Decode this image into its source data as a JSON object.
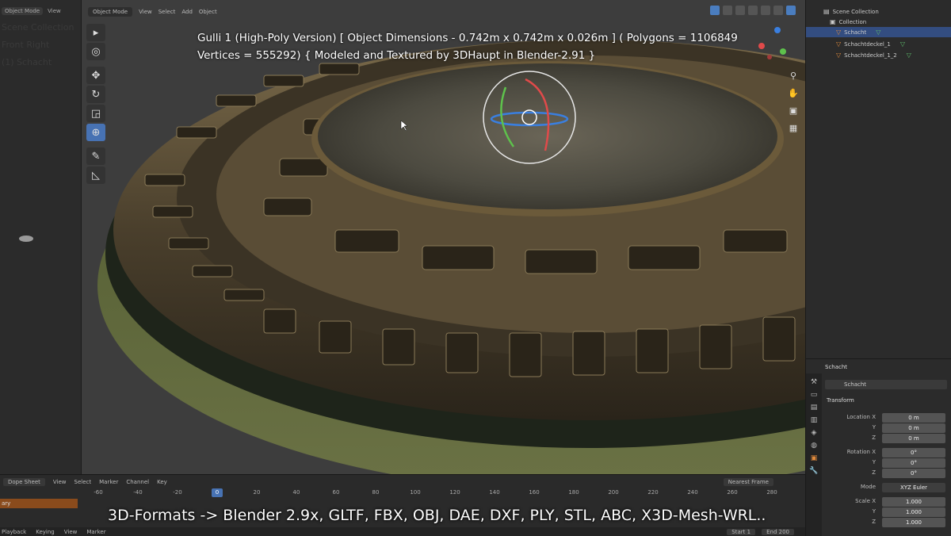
{
  "left": {
    "header_items": [
      "Object Mode",
      "View"
    ],
    "ghost_lines": [
      "Scene Collection",
      "Front Right",
      "(1) Schacht"
    ]
  },
  "viewport": {
    "mode": "Object Mode",
    "menus": [
      "View",
      "Select",
      "Add",
      "Object"
    ],
    "overlay_line1": "Gulli 1 (High-Poly Version) [ Object Dimensions -  0.742m x 0.742m x 0.026m ] ( Polygons = 1106849",
    "overlay_line2": "Vertices = 555292)  { Modeled and Textured by 3DHaupt in Blender-2.91 }",
    "tools": [
      "select-box-icon",
      "cursor-icon",
      "move-icon",
      "rotate-icon",
      "scale-icon",
      "transform-icon",
      "annotate-icon",
      "measure-icon"
    ],
    "nav": [
      "zoom-icon",
      "hand-icon",
      "camera-icon",
      "grid-icon"
    ]
  },
  "outliner": {
    "rows": [
      {
        "label": "Scene Collection",
        "icon": "scene-collection-icon",
        "selected": false
      },
      {
        "label": "Collection",
        "icon": "collection-icon",
        "selected": false
      },
      {
        "label": "Schacht",
        "icon": "mesh-object-icon",
        "selected": true
      },
      {
        "label": "Schachtdeckel_1",
        "icon": "mesh-object-icon",
        "selected": false
      },
      {
        "label": "Schachtdeckel_1_2",
        "icon": "mesh-object-icon",
        "selected": false
      }
    ]
  },
  "properties": {
    "object_header": "Schacht",
    "object_name": "Schacht",
    "section": "Transform",
    "location_x_label": "Location X",
    "location_x": "0 m",
    "location_y_label": "Y",
    "location_y": "0 m",
    "location_z_label": "Z",
    "location_z": "0 m",
    "rotation_x_label": "Rotation X",
    "rotation_x": "0°",
    "rotation_y_label": "Y",
    "rotation_y": "0°",
    "rotation_z_label": "Z",
    "rotation_z": "0°",
    "mode_label": "Mode",
    "mode_value": "XYZ Euler",
    "scale_x_label": "Scale X",
    "scale_x": "1.000",
    "scale_y_label": "Y",
    "scale_y": "1.000",
    "scale_z_label": "Z",
    "scale_z": "1.000"
  },
  "timeline": {
    "editor": "Dope Sheet",
    "menus": [
      "View",
      "Select",
      "Marker",
      "Channel",
      "Key"
    ],
    "snapping": "Nearest Frame",
    "ruler": [
      "-60",
      "-40",
      "-20",
      "20",
      "40",
      "60",
      "80",
      "100",
      "120",
      "140",
      "160",
      "180",
      "200",
      "220",
      "240",
      "260",
      "280"
    ],
    "current_frame": "0",
    "summary_label": "ary",
    "playback": "Playback",
    "keying": "Keying",
    "view": "View",
    "marker": "Marker",
    "start_label": "Start",
    "start_value": "1",
    "end_label": "End",
    "end_value": "200"
  },
  "caption": "3D-Formats -> Blender 2.9x, GLTF, FBX, OBJ, DAE, DXF, PLY, STL, ABC, X3D-Mesh-WRL.."
}
